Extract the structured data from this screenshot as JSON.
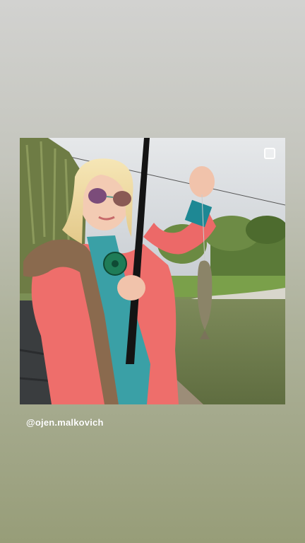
{
  "story": {
    "mention": "@ojen.malkovich",
    "photo_icon": "image-square-icon",
    "colors": {
      "background_top": "#d2d2d0",
      "background_bottom": "#979d78",
      "mention_text": "#ffffff"
    }
  }
}
